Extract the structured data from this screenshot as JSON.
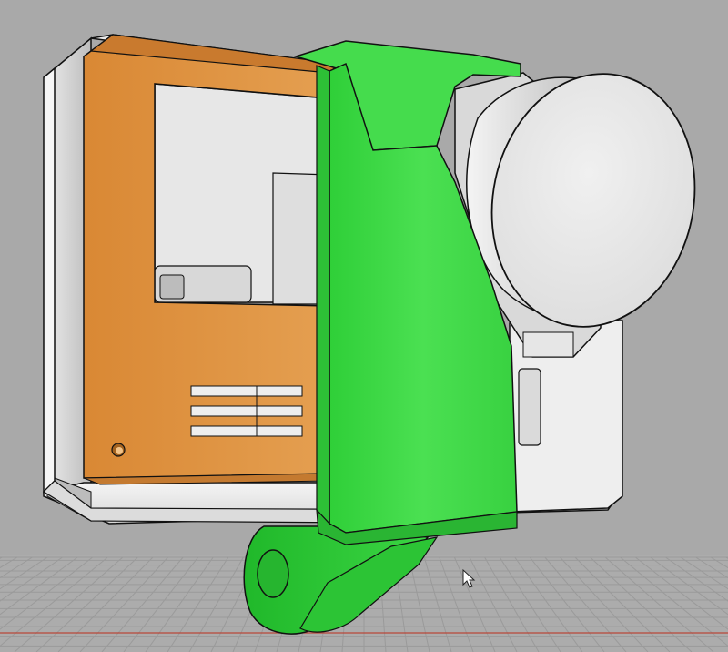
{
  "viewport": {
    "background": "#a9a9a9",
    "grid_color": "#9a9a9a",
    "axis_color": "#c0392b"
  },
  "model": {
    "camera_body_color": "#e6e6e6",
    "frame_color": "#e0963e",
    "mount_color": "#3fd84a",
    "lens_color": "#e8e8e8",
    "edge_color": "#111111"
  },
  "icons": {
    "cursor": "mouse-pointer-icon"
  }
}
